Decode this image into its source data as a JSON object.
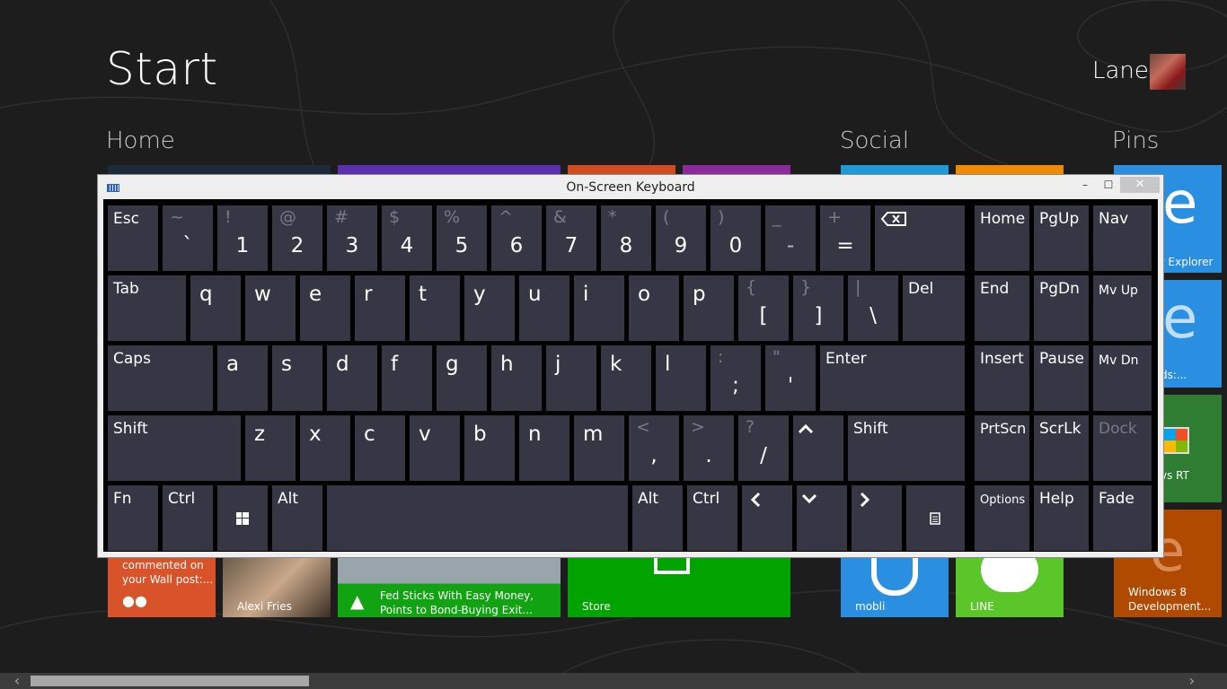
{
  "start": {
    "title": "Start"
  },
  "user": {
    "name": "Lane"
  },
  "groups": {
    "home": "Home",
    "social": "Social",
    "pins": "Pins"
  },
  "tiles": {
    "facebook_text": "commented on\nyour Wall post:...",
    "alexi": "Alexi Fries",
    "news_line1": "Fed Sticks With Easy Money,",
    "news_line2": "Points to Bond-Buying Exit...",
    "store": "Store",
    "mobli": "mobli",
    "line": "LINE",
    "ie": "t Explorer",
    "ie2": "ds:...",
    "rt": "vs RT",
    "win8_line1": "Windows 8",
    "win8_line2": "Development..."
  },
  "osk": {
    "title": "On-Screen Keyboard",
    "controls": {
      "minimize": "–",
      "maximize": "☐",
      "close": "✕"
    },
    "keys": {
      "esc": "Esc",
      "n1": {
        "shift": "~",
        "main": "`"
      },
      "n2": {
        "shift": "!",
        "main": "1"
      },
      "n3": {
        "shift": "@",
        "main": "2"
      },
      "n4": {
        "shift": "#",
        "main": "3"
      },
      "n5": {
        "shift": "$",
        "main": "4"
      },
      "n6": {
        "shift": "%",
        "main": "5"
      },
      "n7": {
        "shift": "^",
        "main": "6"
      },
      "n8": {
        "shift": "&",
        "main": "7"
      },
      "n9": {
        "shift": "*",
        "main": "8"
      },
      "n10": {
        "shift": "(",
        "main": "9"
      },
      "n11": {
        "shift": ")",
        "main": "0"
      },
      "n12": {
        "shift": "_",
        "main": "-"
      },
      "n13": {
        "shift": "+",
        "main": "="
      },
      "home": "Home",
      "pgup": "PgUp",
      "nav": "Nav",
      "tab": "Tab",
      "q": "q",
      "w": "w",
      "e": "e",
      "r": "r",
      "t": "t",
      "y": "y",
      "u": "u",
      "i": "i",
      "o": "o",
      "p": "p",
      "lbrace": {
        "shift": "{",
        "main": "["
      },
      "rbrace": {
        "shift": "}",
        "main": "]"
      },
      "pipe": {
        "shift": "|",
        "main": "\\"
      },
      "del": "Del",
      "end": "End",
      "pgdn": "PgDn",
      "mvup": "Mv Up",
      "caps": "Caps",
      "a": "a",
      "s": "s",
      "d": "d",
      "f": "f",
      "g": "g",
      "h": "h",
      "j": "j",
      "k": "k",
      "l": "l",
      "semi": {
        "shift": ":",
        "main": ";"
      },
      "quote": {
        "shift": "\"",
        "main": "'"
      },
      "enter": "Enter",
      "insert": "Insert",
      "pause": "Pause",
      "mvdn": "Mv Dn",
      "lshift": "Shift",
      "z": "z",
      "x": "x",
      "c": "c",
      "v": "v",
      "b": "b",
      "n": "n",
      "m": "m",
      "comma": {
        "shift": "<",
        "main": ","
      },
      "period": {
        "shift": ">",
        "main": "."
      },
      "slash": {
        "shift": "?",
        "main": "/"
      },
      "rshift": "Shift",
      "prtscn": "PrtScn",
      "scrlk": "ScrLk",
      "dock": "Dock",
      "fn": "Fn",
      "ctrl": "Ctrl",
      "alt": "Alt",
      "alt2": "Alt",
      "ctrl2": "Ctrl",
      "options": "Options",
      "help": "Help",
      "fade": "Fade"
    }
  },
  "colors": {
    "background": "#1d1d1d",
    "key": "#373645",
    "osk_frame": "#efefef"
  }
}
